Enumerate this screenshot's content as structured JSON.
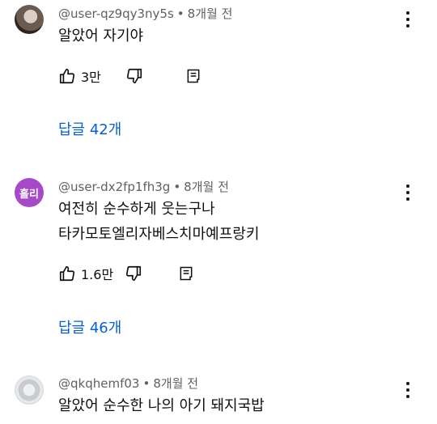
{
  "comments": [
    {
      "author": "@user-qz9qy3ny5s",
      "time": "8개월 전",
      "avatar_type": "photo",
      "lines": [
        "알았어 자기야"
      ],
      "likes": "3만",
      "replies": "답글 42개"
    },
    {
      "author": "@user-dx2fp1fh3g",
      "time": "8개월 전",
      "avatar_type": "letter",
      "avatar_text": "흘리",
      "avatar_color": "#a64ac9",
      "lines": [
        "여전히 순수하게 웃는구나",
        "타카모토엘리자베스치마예프랑키"
      ],
      "likes": "1.6만",
      "replies": "답글 46개"
    },
    {
      "author": "@qkqhemf03",
      "time": "8개월 전",
      "avatar_type": "photo",
      "lines": [
        "알았어 순수한 나의 아기 돼지국밥"
      ]
    }
  ],
  "icons": {
    "like": "thumb-up-icon",
    "dislike": "thumb-down-icon",
    "reply": "reply-icon",
    "more": "more-vert-icon"
  },
  "colors": {
    "link": "#065fd4",
    "secondary_text": "#606060",
    "primary_text": "#0f0f0f"
  }
}
